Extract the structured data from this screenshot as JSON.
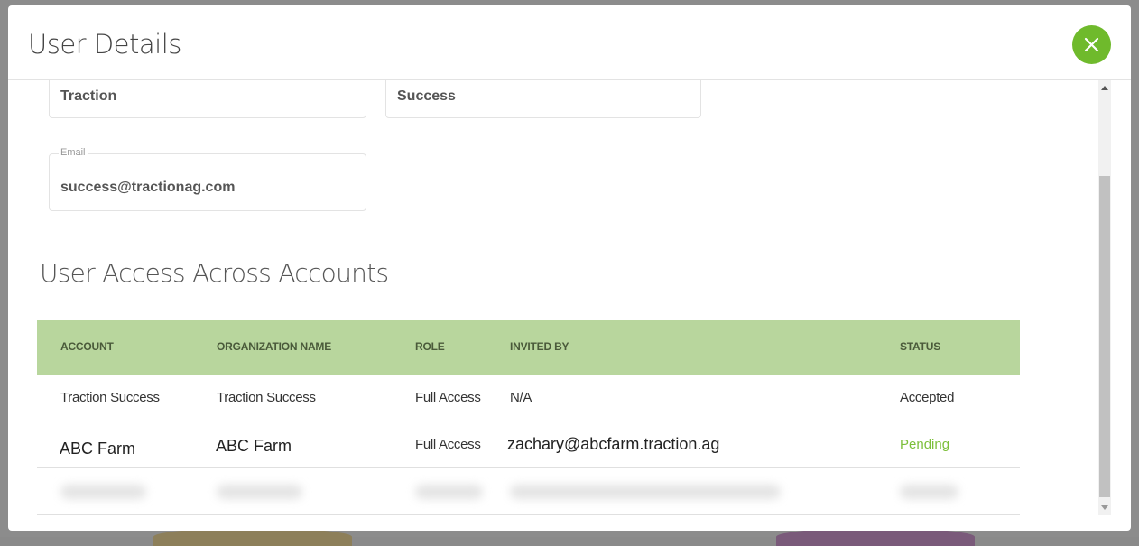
{
  "modal": {
    "title": "User Details",
    "close_icon": "close-icon"
  },
  "form": {
    "first_name_value": "Traction",
    "last_name_value": "Success",
    "email_label": "Email",
    "email_value": "success@tractionag.com"
  },
  "access": {
    "section_title": "User Access Across Accounts",
    "columns": [
      "ACCOUNT",
      "ORGANIZATION NAME",
      "ROLE",
      "INVITED BY",
      "STATUS"
    ],
    "rows": [
      {
        "account": "Traction Success",
        "organization": "Traction Success",
        "role": "Full Access",
        "invited_by": "N/A",
        "status": "Accepted"
      },
      {
        "account": "ABC Farm",
        "organization": "ABC Farm",
        "role": "Full Access",
        "invited_by": "zachary@abcfarm.traction.ag",
        "status": "Pending"
      }
    ]
  },
  "colors": {
    "accent": "#6fba2c",
    "table_header": "#b8d69d",
    "pending": "#7cbf3a"
  }
}
